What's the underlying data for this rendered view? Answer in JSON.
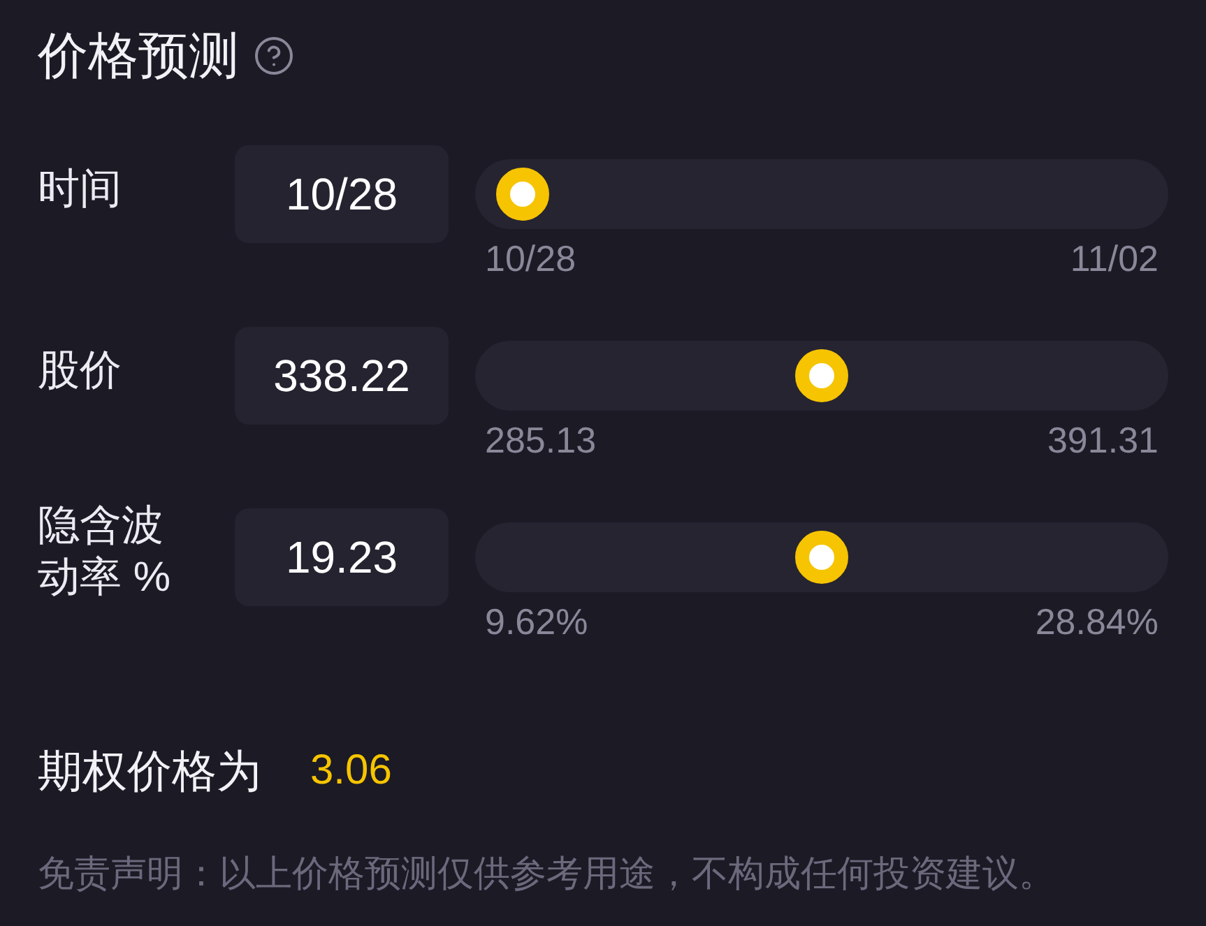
{
  "title": "价格预测",
  "sliders": [
    {
      "label": "时间",
      "value": "10/28",
      "min_label": "10/28",
      "max_label": "11/02",
      "level": 0
    },
    {
      "label": "股价",
      "value": "338.22",
      "min_label": "285.13",
      "max_label": "391.31",
      "level": 0.5
    },
    {
      "label": "隐含波动率 %",
      "value": "19.23",
      "min_label": "9.62%",
      "max_label": "28.84%",
      "level": 0.5
    }
  ],
  "result": {
    "label": "期权价格为",
    "value": "3.06"
  },
  "disclaimer": "免责声明：以上价格预测仅供参考用途，不构成任何投资建议。"
}
